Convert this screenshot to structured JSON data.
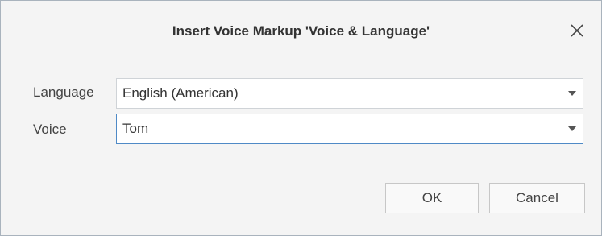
{
  "dialog": {
    "title": "Insert Voice Markup 'Voice & Language'",
    "close_icon": "close-icon"
  },
  "form": {
    "language": {
      "label": "Language",
      "value": "English (American)",
      "icon": "chevron-down-icon"
    },
    "voice": {
      "label": "Voice",
      "value": "Tom",
      "icon": "chevron-down-icon"
    }
  },
  "buttons": {
    "ok_label": "OK",
    "cancel_label": "Cancel"
  },
  "colors": {
    "focus_border": "#4f8ac6",
    "dialog_background": "#f4f4f4"
  }
}
